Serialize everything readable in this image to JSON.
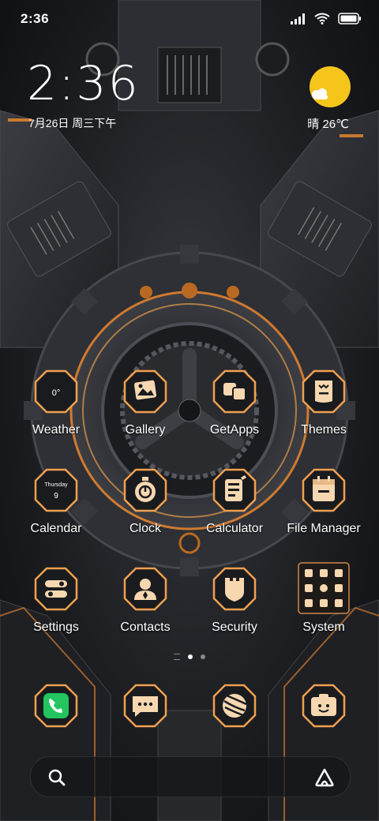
{
  "status_bar": {
    "time": "2:36",
    "icons": [
      "signal-icon",
      "wifi-icon",
      "battery-icon"
    ]
  },
  "clock_widget": {
    "time": "2:36",
    "date": "7月26日 周三下午",
    "weather": "晴 26℃"
  },
  "apps": [
    {
      "label": "Weather",
      "icon": "weather-icon",
      "badge": "0°"
    },
    {
      "label": "Gallery",
      "icon": "gallery-icon"
    },
    {
      "label": "GetApps",
      "icon": "getapps-icon"
    },
    {
      "label": "Themes",
      "icon": "themes-icon"
    },
    {
      "label": "Calendar",
      "icon": "calendar-icon",
      "badge_day": "Thursday",
      "badge_num": "9"
    },
    {
      "label": "Clock",
      "icon": "clock-icon"
    },
    {
      "label": "Calculator",
      "icon": "calculator-icon"
    },
    {
      "label": "File Manager",
      "icon": "file-manager-icon"
    },
    {
      "label": "Settings",
      "icon": "settings-icon"
    },
    {
      "label": "Contacts",
      "icon": "contacts-icon"
    },
    {
      "label": "Security",
      "icon": "security-icon"
    },
    {
      "label": "System",
      "icon": "system-folder-icon"
    }
  ],
  "dock": [
    {
      "icon": "phone-icon"
    },
    {
      "icon": "messages-icon"
    },
    {
      "icon": "browser-icon"
    },
    {
      "icon": "camera-icon"
    }
  ],
  "page_indicator": {
    "pages": 2,
    "active": 1
  },
  "colors": {
    "accent_orange": "#f0a050",
    "icon_fill": "#f6d7b0",
    "phone_green": "#22c55e",
    "sun_yellow": "#f6c51b"
  }
}
